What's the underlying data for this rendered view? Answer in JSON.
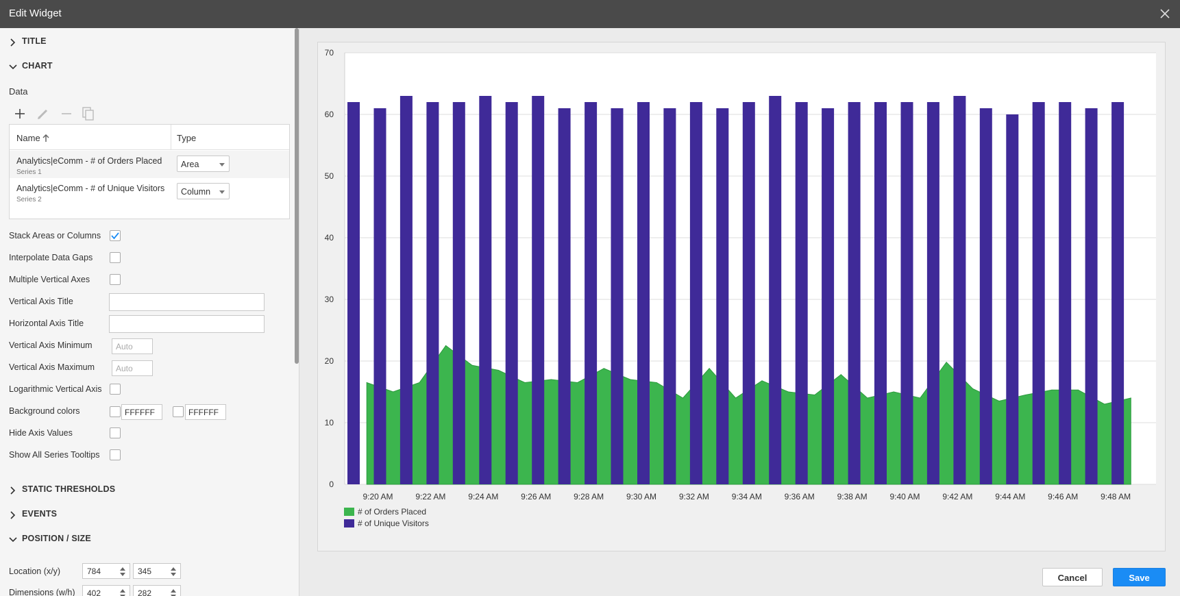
{
  "window": {
    "title": "Edit Widget"
  },
  "sections": {
    "title": "TITLE",
    "chart": "CHART",
    "static_thresholds": "STATIC THRESHOLDS",
    "events": "EVENTS",
    "position_size": "POSITION / SIZE"
  },
  "data_panel": {
    "label": "Data",
    "columns": {
      "name": "Name",
      "type": "Type"
    },
    "rows": [
      {
        "name": "Analytics|eComm - # of Orders Placed",
        "series": "Series 1",
        "type": "Area"
      },
      {
        "name": "Analytics|eComm - # of Unique Visitors",
        "series": "Series 2",
        "type": "Column"
      }
    ]
  },
  "options": {
    "stack": "Stack Areas or Columns",
    "interpolate": "Interpolate Data Gaps",
    "multi_axes": "Multiple Vertical Axes",
    "v_axis_title": "Vertical Axis Title",
    "h_axis_title": "Horizontal Axis Title",
    "v_axis_min": "Vertical Axis Minimum",
    "v_axis_max": "Vertical Axis Maximum",
    "log_axis": "Logarithmic Vertical Axis",
    "bg_colors": "Background colors",
    "hide_axis": "Hide Axis Values",
    "show_tooltips": "Show All Series Tooltips",
    "min_placeholder": "Auto",
    "max_placeholder": "Auto",
    "bg_color_1": "FFFFFF",
    "bg_color_2": "FFFFFF",
    "stack_checked": true
  },
  "position": {
    "location_label": "Location (x/y)",
    "location_x": "784",
    "location_y": "345",
    "dimensions_label": "Dimensions (w/h)",
    "dim_w": "402",
    "dim_h": "282"
  },
  "buttons": {
    "cancel": "Cancel",
    "save": "Save"
  },
  "colors": {
    "orders": "#3cb54e",
    "visitors": "#3f2a98"
  },
  "chart_data": {
    "type": "bar",
    "ylim": [
      0,
      70
    ],
    "yticks": [
      0,
      10,
      20,
      30,
      40,
      50,
      60,
      70
    ],
    "xtick_labels": [
      "9:20 AM",
      "9:22 AM",
      "9:24 AM",
      "9:26 AM",
      "9:28 AM",
      "9:30 AM",
      "9:32 AM",
      "9:34 AM",
      "9:36 AM",
      "9:38 AM",
      "9:40 AM",
      "9:42 AM",
      "9:44 AM",
      "9:46 AM",
      "9:48 AM"
    ],
    "legend": [
      "# of Orders Placed",
      "# of Unique Visitors"
    ],
    "series": [
      {
        "name": "# of Orders Placed",
        "type": "area",
        "values": [
          16.5,
          15,
          16.5,
          22.5,
          19.3,
          18.5,
          16.5,
          17,
          16.5,
          18.8,
          17,
          16.5,
          14,
          18.8,
          14,
          16.8,
          15,
          14.5,
          17.8,
          14,
          15,
          14,
          19.8,
          15.5,
          13.5,
          14.5,
          15.3,
          15.3,
          13,
          14
        ]
      },
      {
        "name": "# of Unique Visitors",
        "type": "column",
        "values": [
          62,
          61,
          63,
          62,
          62,
          63,
          62,
          63,
          61,
          62,
          61,
          62,
          61,
          62,
          61,
          62,
          63,
          62,
          61,
          62,
          62,
          62,
          62,
          63,
          61,
          60,
          62,
          62,
          61,
          62
        ]
      }
    ]
  }
}
